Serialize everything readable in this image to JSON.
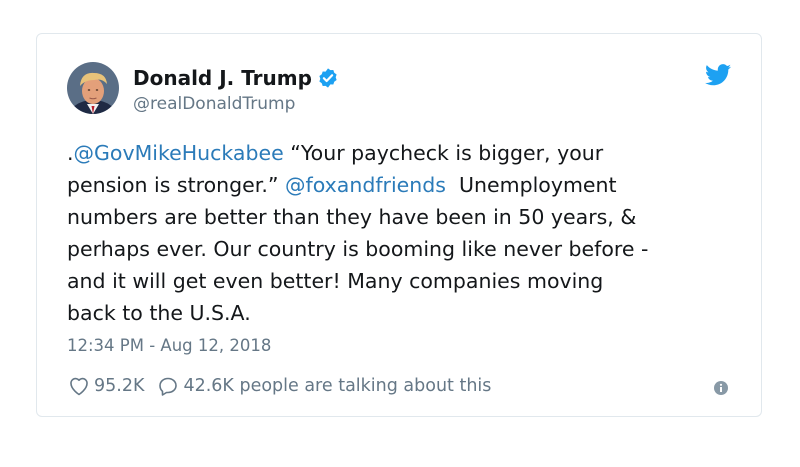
{
  "user": {
    "name": "Donald J. Trump",
    "handle": "@realDonaldTrump",
    "avatar_icon": "profile-photo-icon",
    "verified_icon": "verified-badge-icon"
  },
  "brand": {
    "icon": "twitter-bird-icon",
    "color": "#1da1f2"
  },
  "tweet": {
    "lines": [
      [
        {
          "text": ".",
          "mention": false
        },
        {
          "text": "@GovMikeHuckabee",
          "mention": true
        },
        {
          "text": " “Your paycheck is bigger, your",
          "mention": false
        }
      ],
      [
        {
          "text": "pension is stronger.” ",
          "mention": false
        },
        {
          "text": "@foxandfriends",
          "mention": true
        },
        {
          "text": "  Unemployment",
          "mention": false
        }
      ],
      [
        {
          "text": "numbers are better than they have been in 50 years, &",
          "mention": false
        }
      ],
      [
        {
          "text": "perhaps ever. Our country is booming like never before -",
          "mention": false
        }
      ],
      [
        {
          "text": "and it will get even better! Many companies moving",
          "mention": false
        }
      ],
      [
        {
          "text": "back to the U.S.A.",
          "mention": false
        }
      ]
    ],
    "timestamp": "12:34 PM - Aug 12, 2018"
  },
  "engagement": {
    "likes": "95.2K",
    "replies_text": "42.6K people are talking about this",
    "like_icon": "heart-icon",
    "reply_icon": "speech-bubble-icon",
    "info_icon": "info-icon"
  },
  "colors": {
    "text": "#14171a",
    "secondary": "#657786",
    "link": "#2b7bb9",
    "border": "#e1e8ed"
  }
}
